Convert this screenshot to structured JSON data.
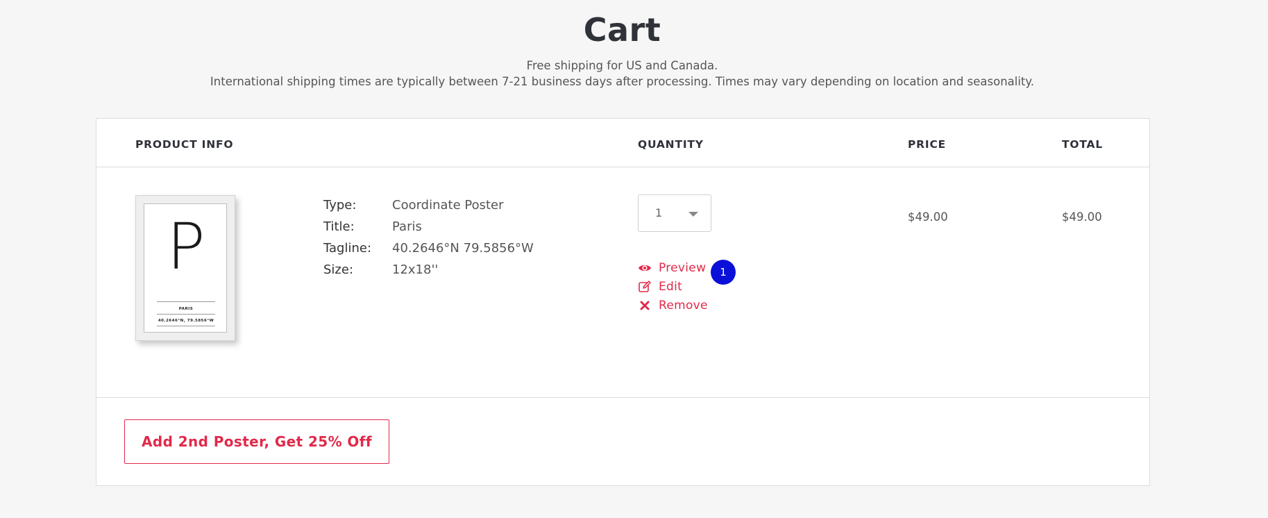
{
  "page": {
    "title": "Cart",
    "shipping_line_1": "Free shipping for US and Canada.",
    "shipping_line_2": "International shipping times are typically between 7-21 business days after processing. Times may vary depending on location and seasonality."
  },
  "table": {
    "headers": {
      "product_info": "PRODUCT INFO",
      "quantity": "QUANTITY",
      "price": "PRICE",
      "total": "TOTAL"
    }
  },
  "item": {
    "poster": {
      "letter": "P",
      "caption_title": "PARIS",
      "caption_coords": "40.2646°N, 79.5856°W"
    },
    "details": [
      {
        "label": "Type:",
        "value": "Coordinate Poster"
      },
      {
        "label": "Title:",
        "value": "Paris"
      },
      {
        "label": "Tagline:",
        "value": "40.2646°N 79.5856°W"
      },
      {
        "label": "Size:",
        "value": "12x18''"
      }
    ],
    "quantity": "1",
    "actions": {
      "preview": "Preview",
      "edit": "Edit",
      "remove": "Remove"
    },
    "preview_badge": "1",
    "price": "$49.00",
    "total": "$49.00"
  },
  "offer_button": "Add 2nd Poster, Get 25% Off",
  "colors": {
    "accent": "#e1294a",
    "badge": "#0a10d8",
    "page_bg": "#f6f6f6",
    "heading": "#2f3238"
  },
  "icons": {
    "preview": "eye-icon",
    "edit": "edit-icon",
    "remove": "close-icon",
    "dropdown": "chevron-down-icon"
  }
}
